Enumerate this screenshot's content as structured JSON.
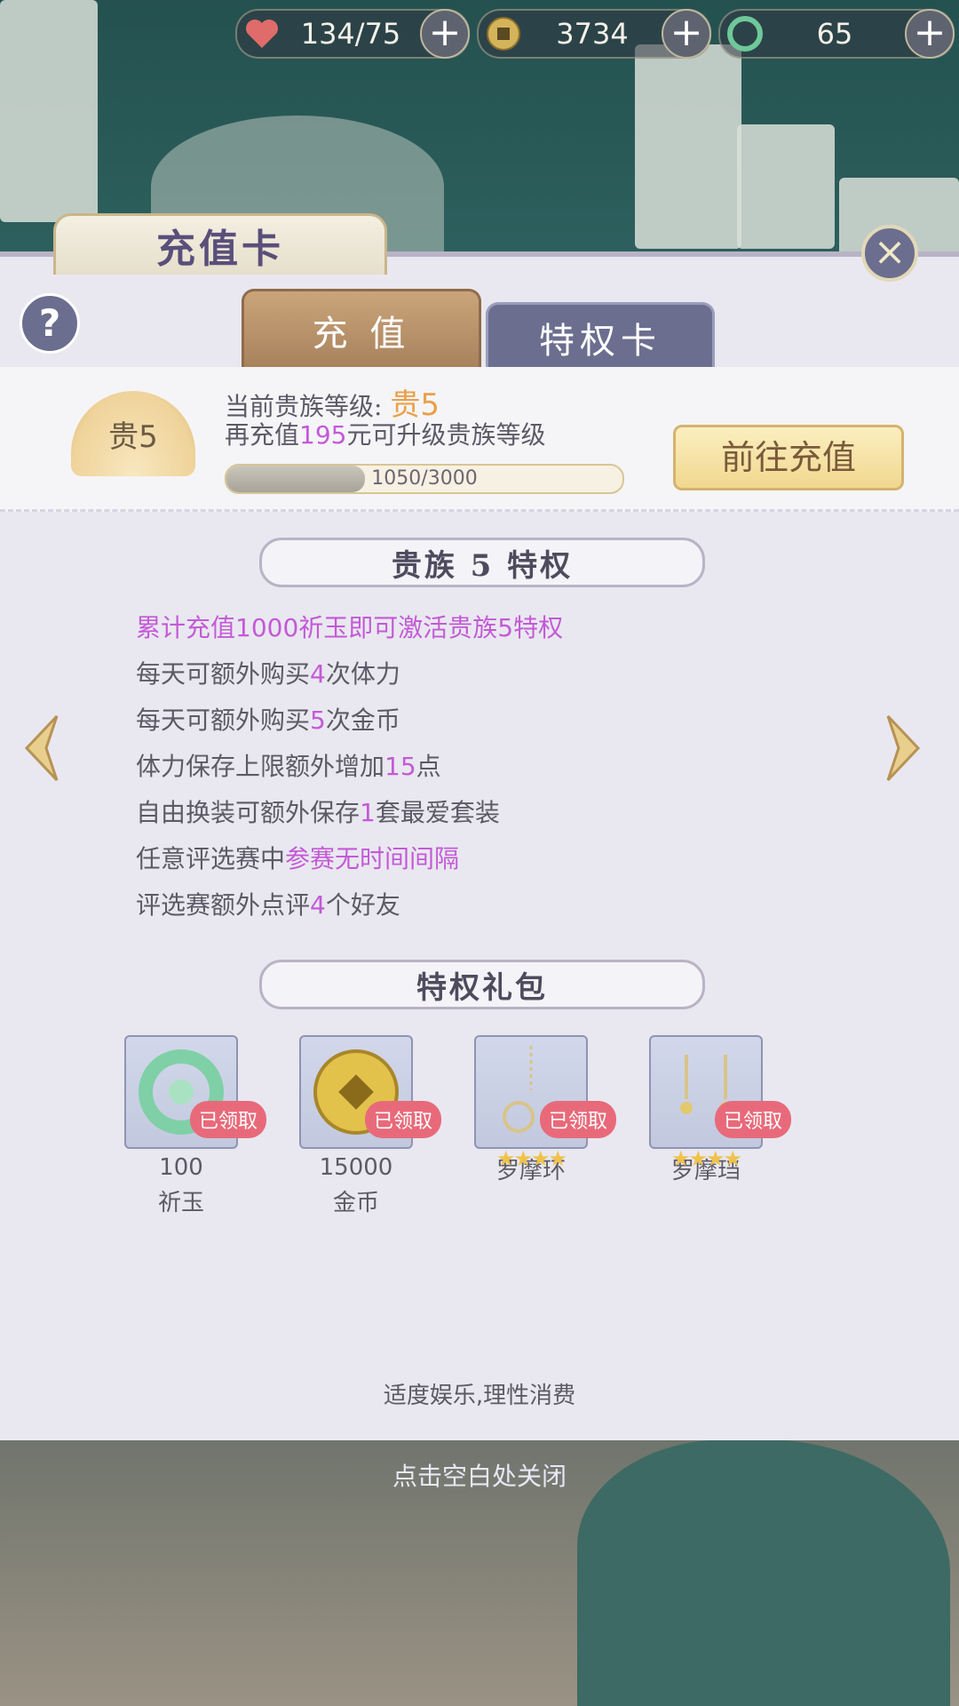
{
  "resources": [
    {
      "icon": "heart-icon",
      "value": "134/75",
      "color": "#e06b6b"
    },
    {
      "icon": "coin-icon",
      "value": "3734",
      "color": "#d4b45a"
    },
    {
      "icon": "jade-icon",
      "value": "65",
      "color": "#6fc89a"
    }
  ],
  "panel": {
    "title": "充值卡",
    "help": "?",
    "close": "×"
  },
  "tabs": {
    "recharge": "充 值",
    "privilege_card": "特权卡"
  },
  "vip": {
    "badge": "贵5",
    "level_label": "当前贵族等级:",
    "level_value": "贵5",
    "upgrade_prefix": "再充值",
    "upgrade_amount": "195",
    "upgrade_suffix": "元可升级贵族等级",
    "progress_text": "1050/3000",
    "progress": 0.35,
    "recharge_button": "前往充值"
  },
  "privileges": {
    "header": "贵族 5 特权",
    "lines": [
      {
        "pre": "累计充值1000祈玉即可激活贵族5特权",
        "hl": "",
        "post": ""
      },
      {
        "pre": "每天可额外购买",
        "hl": "4",
        "post": "次体力"
      },
      {
        "pre": "每天可额外购买",
        "hl": "5",
        "post": "次金币"
      },
      {
        "pre": "体力保存上限额外增加",
        "hl": "15",
        "post": "点"
      },
      {
        "pre": "自由换装可额外保存",
        "hl": "1",
        "post": "套最爱套装"
      },
      {
        "pre": "任意评选赛中",
        "hl": "参赛无时间间隔",
        "post": ""
      },
      {
        "pre": "评选赛额外点评",
        "hl": "4",
        "post": "个好友"
      }
    ]
  },
  "gifts": {
    "header": "特权礼包",
    "claimed_label": "已领取",
    "items": [
      {
        "icon": "jade-dragon-icon",
        "count": "100",
        "name": "祈玉",
        "stars": ""
      },
      {
        "icon": "gold-coin-icon",
        "count": "15000",
        "name": "金币",
        "stars": ""
      },
      {
        "icon": "bracelet-icon",
        "count": "",
        "name": "罗摩环",
        "stars": "★★★★"
      },
      {
        "icon": "earring-icon",
        "count": "",
        "name": "罗摩珰",
        "stars": "★★★★"
      }
    ]
  },
  "footer_note": "适度娱乐,理性消费",
  "close_hint": "点击空白处关闭"
}
